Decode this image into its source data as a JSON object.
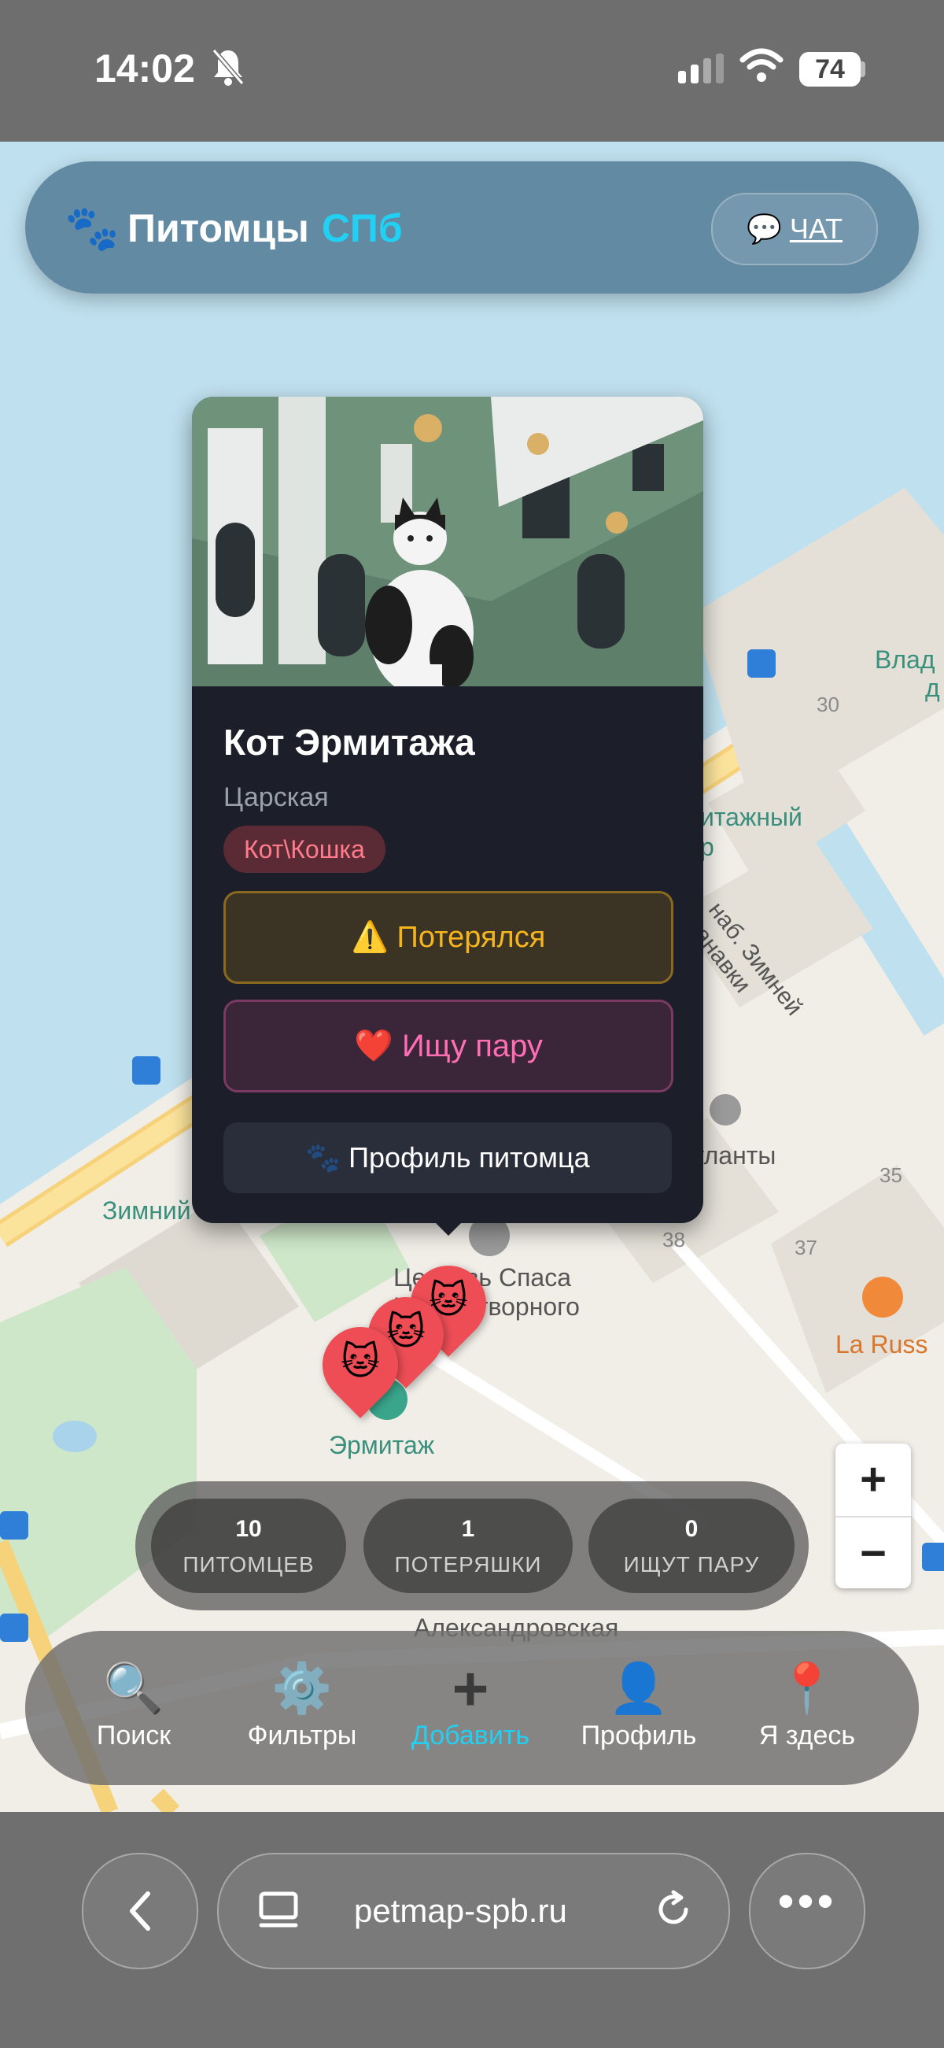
{
  "status_bar": {
    "time": "14:02",
    "battery": "74"
  },
  "header": {
    "title_main": "Питомцы",
    "title_accent": "СПб",
    "chat_label": "ЧАТ"
  },
  "map": {
    "labels": {
      "vlad": "Влад",
      "vlad2": "д",
      "sad": "итажный",
      "sad2": "р",
      "atlanty": "Атланты",
      "zimniy": "Зимний",
      "church": "Церковь Спаса",
      "church2": "Нерукотворного",
      "ermitazh": "Эрмитаж",
      "la_russ": "La Russ",
      "alex": "Александровская",
      "kanal": "наб. Зимней канавки"
    },
    "numbers": {
      "n30": "30",
      "n35": "35",
      "n37": "37",
      "n38": "38"
    }
  },
  "popup": {
    "name": "Кот Эрмитажа",
    "area": "Царская",
    "tag": "Кот\\Кошка",
    "lost_label": "⚠️ Потерялся",
    "pair_label": "❤️ Ищу пару",
    "profile_label": "Профиль питомца"
  },
  "markers": [
    "🐱",
    "🐱",
    "🐱"
  ],
  "stats": [
    {
      "num": "10",
      "label": "ПИТОМЦЕВ"
    },
    {
      "num": "1",
      "label": "ПОТЕРЯШКИ"
    },
    {
      "num": "0",
      "label": "ИЩУТ ПАРУ"
    }
  ],
  "nav": [
    {
      "icon": "🔍",
      "label": "Поиск"
    },
    {
      "icon": "⚙️",
      "label": "Фильтры"
    },
    {
      "icon": "+",
      "label": "Добавить"
    },
    {
      "icon": "👤",
      "label": "Профиль"
    },
    {
      "icon": "📍",
      "label": "Я здесь"
    }
  ],
  "zoom": {
    "in": "+",
    "out": "−"
  },
  "browser": {
    "url": "petmap-spb.ru"
  },
  "colors": {
    "accent": "#21d0f2",
    "lost": "#f6b41d",
    "pair": "#ff6eb4",
    "marker": "#ee4d55"
  }
}
